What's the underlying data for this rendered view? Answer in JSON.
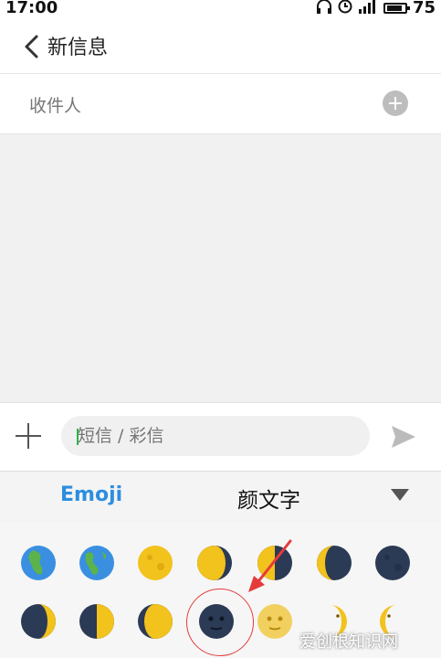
{
  "status_bar": {
    "time": "17:00",
    "battery": "75"
  },
  "header": {
    "title": "新信息"
  },
  "recipient": {
    "label": "收件人"
  },
  "compose": {
    "placeholder": "短信 / 彩信"
  },
  "emoji_tabs": {
    "emoji_label": "Emoji",
    "kaomoji_label": "颜文字"
  },
  "emoji_grid": {
    "row1": [
      "earth-africa-icon",
      "earth-americas-icon",
      "full-moon-icon",
      "waning-gibbous-moon-icon",
      "last-quarter-moon-icon",
      "waning-crescent-moon-icon",
      "new-moon-icon"
    ],
    "row2": [
      "waxing-crescent-moon-icon",
      "first-quarter-moon-icon",
      "waxing-gibbous-moon-icon",
      "new-moon-face-icon",
      "full-moon-face-icon",
      "first-quarter-moon-face-icon",
      "last-quarter-moon-face-icon"
    ]
  },
  "watermark": "爱创根知识网",
  "colors": {
    "accent": "#2d8ee0",
    "highlight": "#e63b3b",
    "cursor": "#2db54a"
  }
}
